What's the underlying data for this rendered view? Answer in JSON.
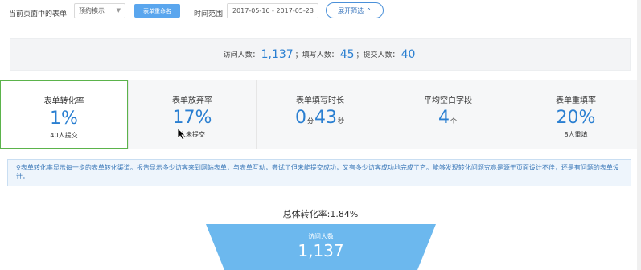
{
  "toolbar": {
    "current_form_label": "当前页面中的表单:",
    "form_select_value": "预约模示",
    "rename_button": "表单重命名",
    "time_range_label": "时间范围:",
    "date_range_value": "2017-05-16 - 2017-05-23",
    "expand_filter_button": "展开筛选"
  },
  "summary": {
    "visits_label": "访问人数：",
    "visits_value": "1,137",
    "fill_label": "；填写人数：",
    "fill_value": "45",
    "submit_label": "；提交人数：",
    "submit_value": "40"
  },
  "cards": [
    {
      "title": "表单转化率",
      "value": "1%",
      "sub": "40人提交",
      "active": true
    },
    {
      "title": "表单放弃率",
      "value": "17%",
      "sub": "人未提交"
    },
    {
      "title": "表单填写时长",
      "value_min": "0",
      "unit_min": "分",
      "value_sec": "43",
      "unit_sec": "秒"
    },
    {
      "title": "平均空白字段",
      "value": "4",
      "unit": "个"
    },
    {
      "title": "表单重填率",
      "value": "20%",
      "sub": "8人重填"
    }
  ],
  "note": {
    "text": "表单转化率显示每一步的表单转化渠道。报告显示多少访客来到网站表单，与表单互动，尝试了但未能提交成功，又有多少访客成功地完成了它。能够发现转化问题究竟是源于页面设计不佳，还是有问题的表单设计。"
  },
  "funnel": {
    "total_rate_label": "总体转化率:1.84%",
    "step_label": "访问人数",
    "step_value": "1,137",
    "color": "#6cb8ee"
  }
}
